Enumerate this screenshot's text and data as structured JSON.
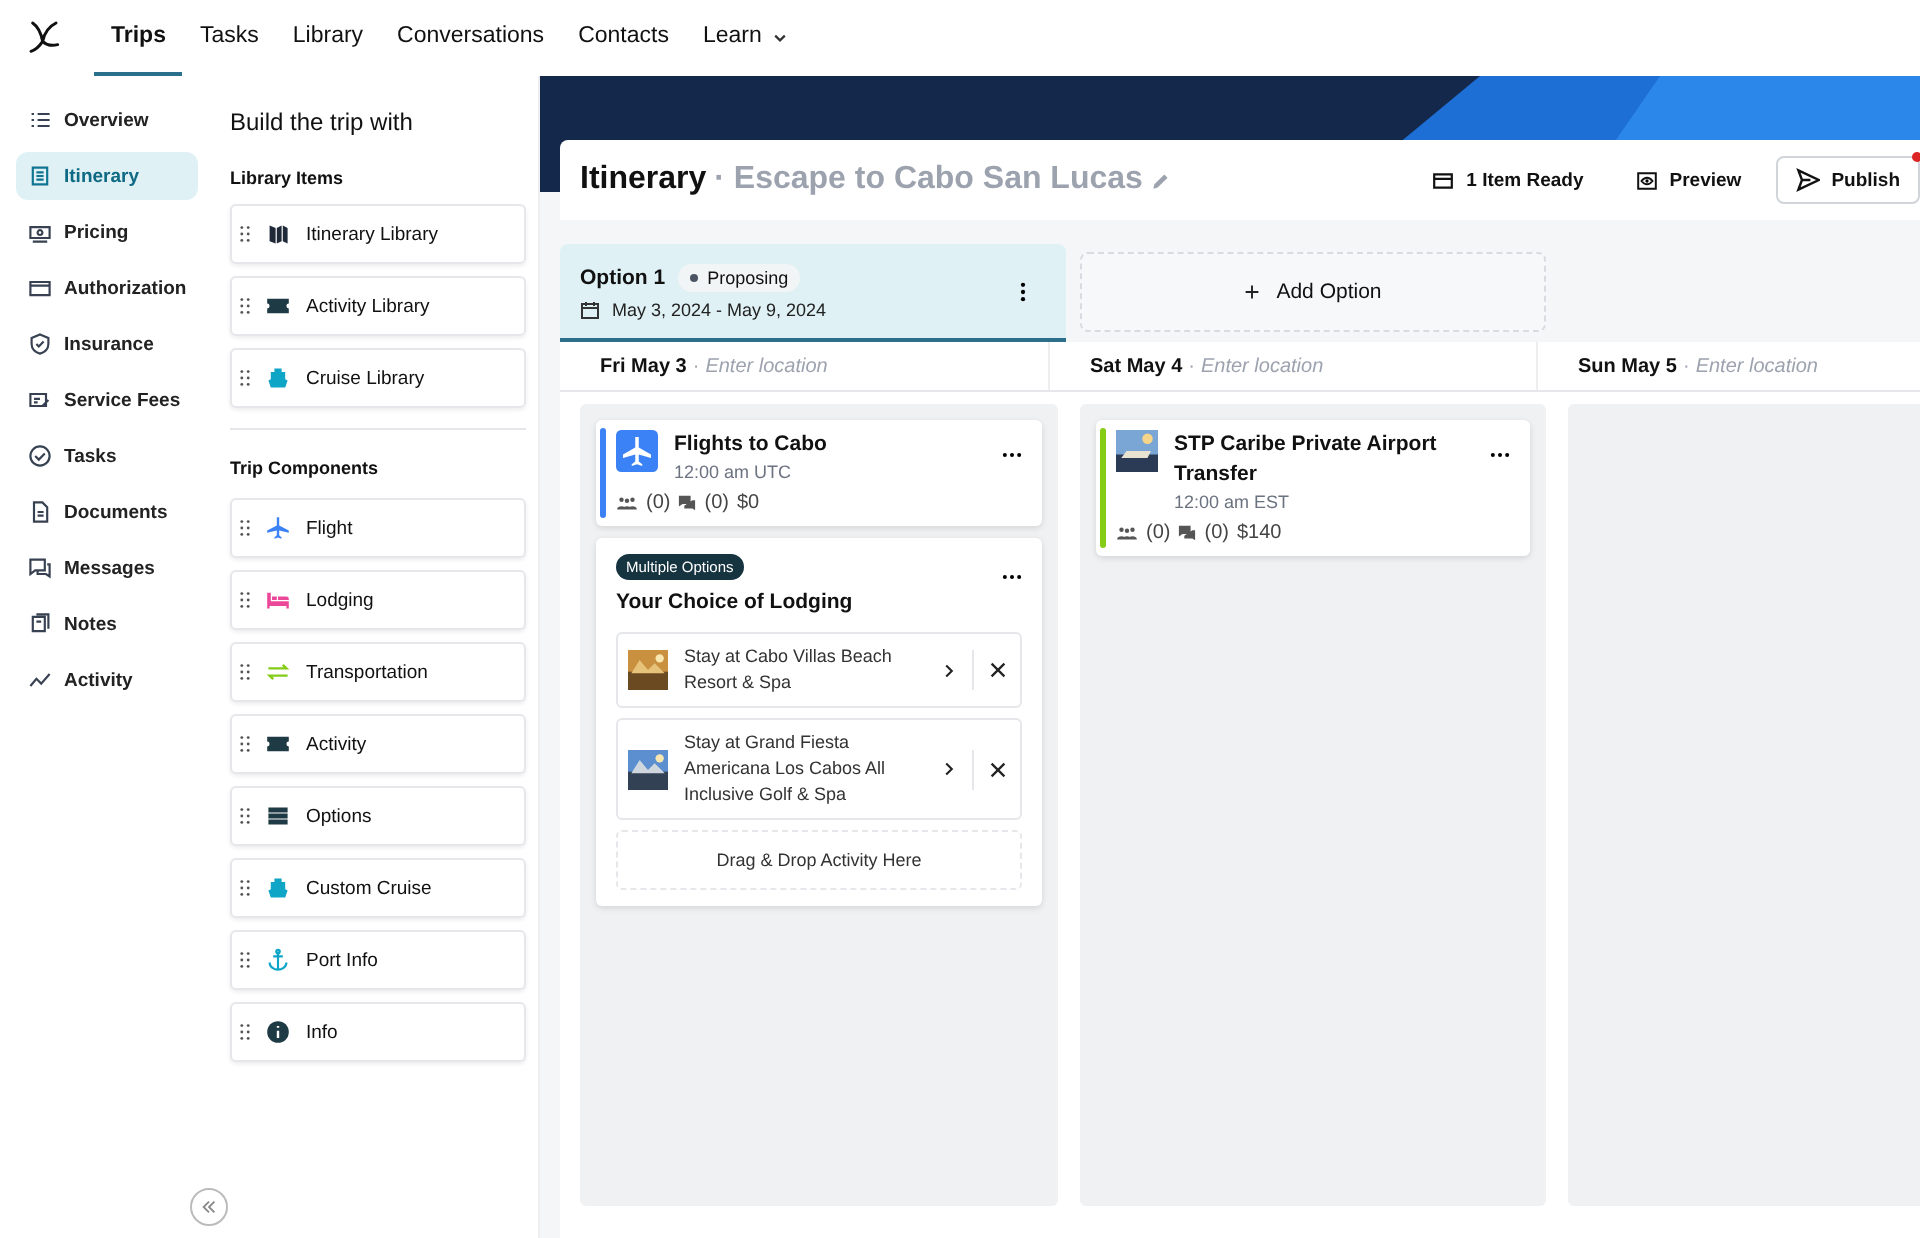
{
  "top_nav": [
    {
      "label": "Trips",
      "selected": true,
      "has_menu": false
    },
    {
      "label": "Tasks",
      "selected": false,
      "has_menu": false
    },
    {
      "label": "Library",
      "selected": false,
      "has_menu": false
    },
    {
      "label": "Conversations",
      "selected": false,
      "has_menu": false
    },
    {
      "label": "Contacts",
      "selected": false,
      "has_menu": false
    },
    {
      "label": "Learn",
      "selected": false,
      "has_menu": true
    }
  ],
  "sidebar": {
    "items": [
      {
        "label": "Overview",
        "kind": "list",
        "selected": false
      },
      {
        "label": "Itinerary",
        "kind": "itinerary",
        "selected": true
      },
      {
        "label": "Pricing",
        "kind": "money",
        "selected": false
      },
      {
        "label": "Authorization",
        "kind": "card",
        "selected": false
      },
      {
        "label": "Insurance",
        "kind": "shield",
        "selected": false
      },
      {
        "label": "Service Fees",
        "kind": "fee",
        "selected": false
      },
      {
        "label": "Tasks",
        "kind": "check",
        "selected": false
      },
      {
        "label": "Documents",
        "kind": "document",
        "selected": false
      },
      {
        "label": "Messages",
        "kind": "chat",
        "selected": false
      },
      {
        "label": "Notes",
        "kind": "notes",
        "selected": false
      },
      {
        "label": "Activity",
        "kind": "trend",
        "selected": false
      }
    ]
  },
  "builder": {
    "title": "Build the trip with",
    "library_heading": "Library Items",
    "library_items": [
      {
        "label": "Itinerary Library",
        "kind": "map"
      },
      {
        "label": "Activity Library",
        "kind": "ticket"
      },
      {
        "label": "Cruise Library",
        "kind": "ship"
      }
    ],
    "components_heading": "Trip Components",
    "components": [
      {
        "label": "Flight",
        "kind": "plane"
      },
      {
        "label": "Lodging",
        "kind": "bed"
      },
      {
        "label": "Transportation",
        "kind": "transfer"
      },
      {
        "label": "Activity",
        "kind": "ticket"
      },
      {
        "label": "Options",
        "kind": "options"
      },
      {
        "label": "Custom Cruise",
        "kind": "ship"
      },
      {
        "label": "Port Info",
        "kind": "anchor"
      },
      {
        "label": "Info",
        "kind": "info"
      }
    ]
  },
  "header": {
    "title": "Itinerary",
    "separator": "·",
    "trip_name": "Escape to Cabo San Lucas",
    "actions": [
      {
        "label": "1 Item Ready",
        "kind": "ready",
        "notification": false
      },
      {
        "label": "Preview",
        "kind": "preview",
        "notification": false
      },
      {
        "label": "Publish",
        "kind": "publish",
        "notification": true
      }
    ]
  },
  "options": [
    {
      "name": "Option 1",
      "status": "Proposing",
      "dates": "May 3, 2024 - May 9, 2024",
      "selected": true
    }
  ],
  "add_option": "Add Option",
  "days": [
    {
      "label": "Fri May 3",
      "placeholder": "Enter location",
      "cards": [
        {
          "kind": "flight",
          "color": "#3b82f6",
          "title": "Flights to Cabo",
          "time": "12:00 am UTC",
          "travelers": "(0)",
          "messages": "(0)",
          "price": "$0"
        },
        {
          "kind": "group",
          "badge": "Multiple Options",
          "title": "Your Choice of Lodging",
          "choices": [
            "Stay at Cabo Villas Beach Resort & Spa",
            "Stay at Grand Fiesta Americana Los Cabos All Inclusive Golf & Spa"
          ],
          "drop": "Drag & Drop Activity Here"
        }
      ]
    },
    {
      "label": "Sat May 4",
      "placeholder": "Enter location",
      "cards": [
        {
          "kind": "transfer",
          "color": "#84cc16",
          "title": "STP Caribe Private Airport Transfer",
          "time": "12:00 am EST",
          "travelers": "(0)",
          "messages": "(0)",
          "price": "$140"
        }
      ]
    },
    {
      "label": "Sun May 5",
      "placeholder": "Enter location"
    }
  ]
}
